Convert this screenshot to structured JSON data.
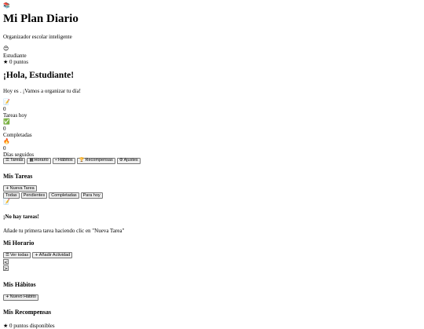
{
  "app": {
    "logo_icon": "books-icon",
    "logo_glyph": "📚",
    "title": "Mi Plan Diario",
    "subtitle": "Organizador escolar inteligente"
  },
  "user": {
    "avatar_glyph": "😊",
    "role": "Estudiante",
    "star_glyph": "★",
    "points": "0 puntos"
  },
  "greeting": {
    "title": "¡Hola, Estudiante!",
    "message": "Hoy es . ¡Vamos a organizar tu día!"
  },
  "stats": [
    {
      "icon": "memo-icon",
      "glyph": "📝",
      "value": "0",
      "label": "Tareas hoy"
    },
    {
      "icon": "check-icon",
      "glyph": "✅",
      "value": "0",
      "label": "Completadas"
    },
    {
      "icon": "fire-icon",
      "glyph": "🔥",
      "value": "0",
      "label": "Días seguidos"
    }
  ],
  "nav": [
    {
      "icon": "list-icon",
      "glyph": "☰",
      "label": "Tareas"
    },
    {
      "icon": "calendar-icon",
      "glyph": "▦",
      "label": "Horario"
    },
    {
      "icon": "chart-icon",
      "glyph": "⌁",
      "label": "Hábitos"
    },
    {
      "icon": "trophy-icon",
      "glyph": "🏆",
      "label": "Recompensas"
    },
    {
      "icon": "gear-icon",
      "glyph": "⚙",
      "label": "Ajustes"
    }
  ],
  "tasks": {
    "title": "Mis Tareas",
    "new_button": "Nueva Tarea",
    "new_glyph": "+",
    "filters": [
      "Todas",
      "Pendientes",
      "Completadas",
      "Para hoy"
    ],
    "empty_glyph": "📝",
    "empty_title": "¡No hay tareas!",
    "empty_message": "Añade tu primera tarea haciendo clic en \"Nueva Tarea\""
  },
  "schedule": {
    "title": "Mi Horario",
    "view_all": "Ver todas",
    "view_all_glyph": "☰",
    "add_activity": "Añadir Actividad",
    "add_glyph": "+",
    "prev_glyph": "<",
    "next_glyph": ">"
  },
  "habits": {
    "title": "Mis Hábitos",
    "new_button": "Nuevo Hábito",
    "new_glyph": "+"
  },
  "rewards": {
    "title": "Mis Recompensas",
    "star_glyph": "★",
    "points_available": "0 puntos disponibles"
  }
}
